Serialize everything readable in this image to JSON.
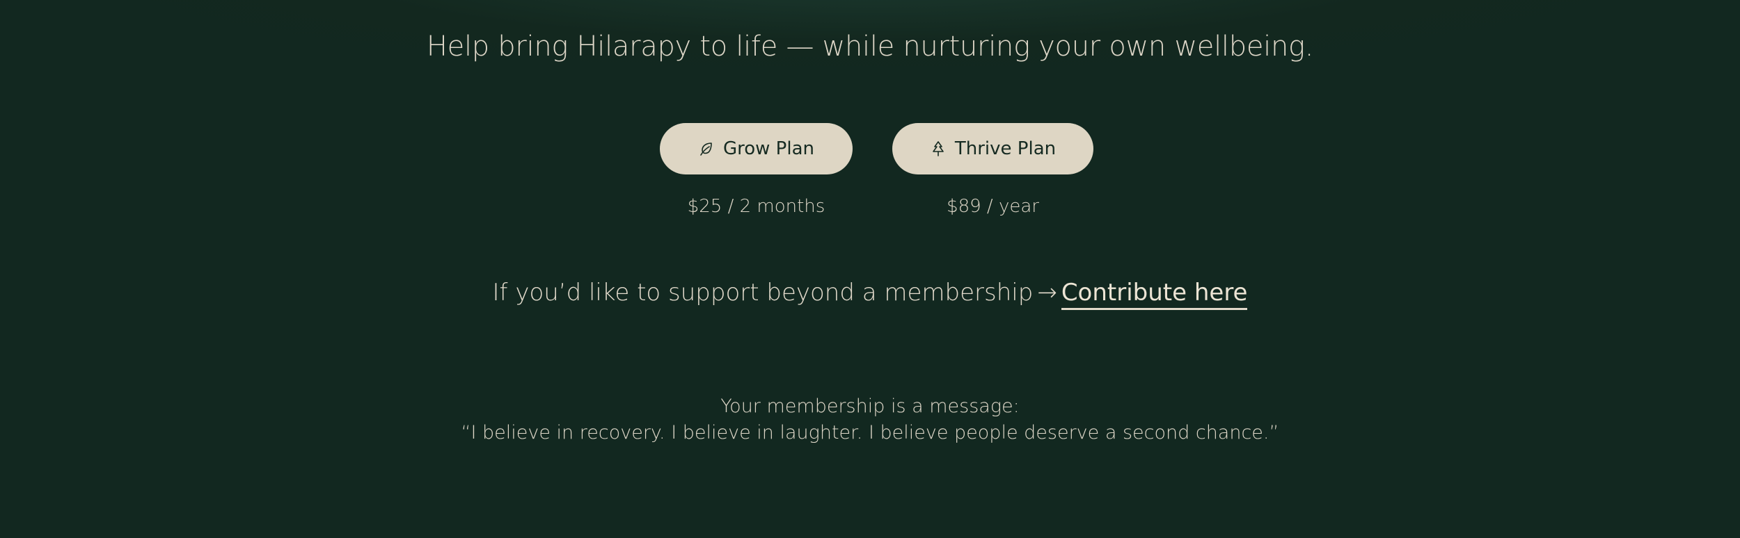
{
  "headline": "Help bring Hilarapy to life — while nurturing your own wellbeing.",
  "plans": [
    {
      "label": "Grow Plan",
      "price": "$25 / 2 months",
      "icon": "leaf-icon"
    },
    {
      "label": "Thrive Plan",
      "price": "$89 / year",
      "icon": "tree-icon"
    }
  ],
  "support": {
    "text": "If you’d like to support beyond a membership",
    "arrow": "→",
    "link_label": "Contribute here"
  },
  "message": {
    "line1": "Your membership is a message:",
    "line2": "“I believe in recovery. I believe in laughter. I believe people deserve a second chance.”"
  },
  "colors": {
    "background": "#122820",
    "button_bg": "#ded6c4",
    "button_text": "#152a21",
    "text": "#ded7c8"
  }
}
